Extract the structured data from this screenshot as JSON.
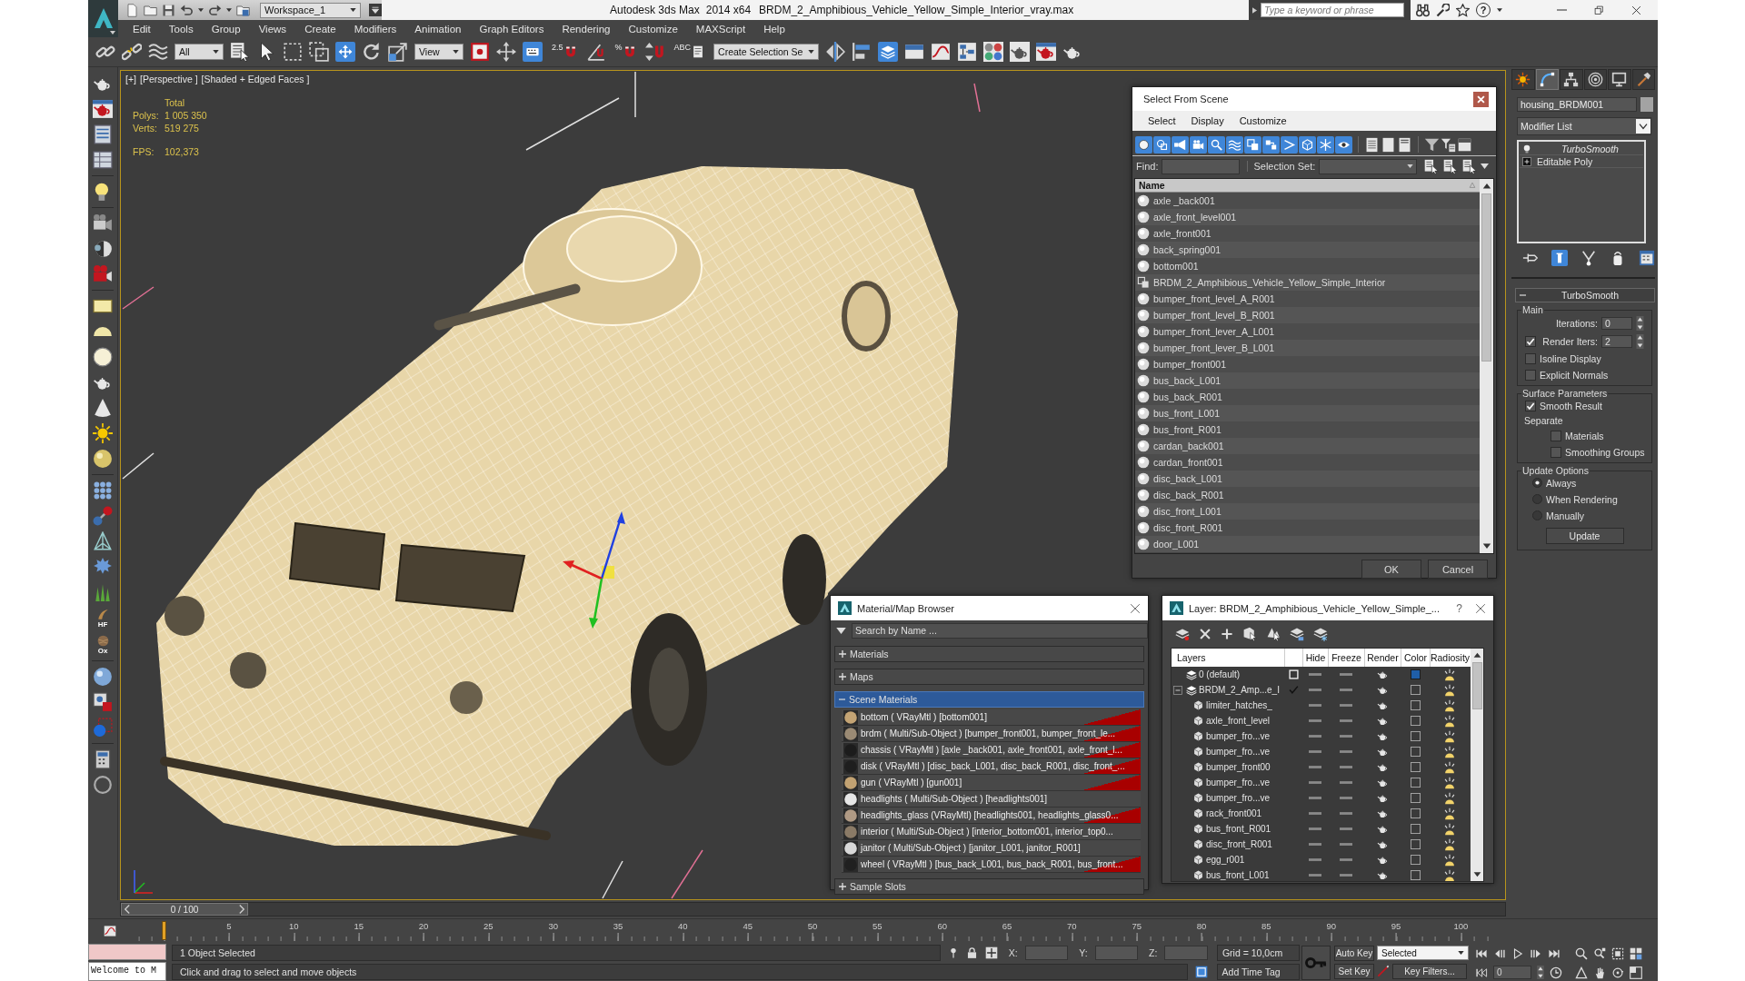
{
  "title_bar": {
    "workspace": "Workspace_1",
    "app_name": "Autodesk 3ds Max",
    "version": "2014 x64",
    "file_name": "BRDM_2_Amphibious_Vehicle_Yellow_Simple_Interior_vray.max",
    "search": {
      "placeholder": "Type a keyword or phrase"
    },
    "help": "?"
  },
  "menu_bar": [
    "Edit",
    "Tools",
    "Group",
    "Views",
    "Create",
    "Modifiers",
    "Animation",
    "Graph Editors",
    "Rendering",
    "Customize",
    "MAXScript",
    "Help"
  ],
  "main_toolbar": [
    {
      "kind": "link",
      "selected": false
    },
    {
      "kind": "unlink",
      "selected": false
    },
    {
      "kind": "bind",
      "selected": false
    },
    {
      "kind": "dropdown",
      "value": "All"
    },
    {
      "kind": "select_by_name",
      "selected": false
    },
    {
      "kind": "select",
      "selected": false
    },
    {
      "kind": "region",
      "selected": false
    },
    {
      "kind": "crossing",
      "selected": false
    },
    {
      "kind": "move",
      "selected": true
    },
    {
      "kind": "rotate",
      "selected": false
    },
    {
      "kind": "scale",
      "selected": false
    },
    {
      "kind": "dropdown",
      "value": "View"
    },
    {
      "kind": "pivot",
      "selected": false
    },
    {
      "kind": "manipulate",
      "selected": false
    },
    {
      "kind": "keyboard",
      "selected": true
    },
    {
      "kind": "snap",
      "label": "2.5",
      "selected": false
    },
    {
      "kind": "angle_snap",
      "selected": false
    },
    {
      "kind": "percent_snap",
      "label": "%",
      "selected": false
    },
    {
      "kind": "spinner_snap",
      "selected": false
    },
    {
      "kind": "edit_named",
      "label": "ABC",
      "selected": false
    },
    {
      "kind": "dropdown",
      "value": "Create Selection Se"
    },
    {
      "kind": "mirror",
      "selected": false
    },
    {
      "kind": "align",
      "selected": false
    },
    {
      "kind": "layers",
      "selected": true
    },
    {
      "kind": "ribbon",
      "selected": false
    },
    {
      "kind": "curve_editor",
      "selected": false
    },
    {
      "kind": "schematic",
      "selected": false
    },
    {
      "kind": "material_editor",
      "selected": false
    },
    {
      "kind": "render_setup",
      "selected": false
    },
    {
      "kind": "frame_window",
      "selected": false
    },
    {
      "kind": "render",
      "selected": false
    }
  ],
  "left_toolbar": {
    "labels": [
      "HF",
      "Ox"
    ]
  },
  "viewport": {
    "labels": [
      "[+]",
      "[Perspective ]",
      "[Shaded + Edged Faces ]"
    ],
    "stats_heading": "Total",
    "stats": [
      {
        "label": "Polys:",
        "value": "1 005 350"
      },
      {
        "label": "Verts:",
        "value": "519 275"
      },
      {
        "label": "FPS:",
        "value": "102,373"
      }
    ]
  },
  "select_from_scene": {
    "title": "Select From Scene",
    "menu": [
      "Select",
      "Display",
      "Customize"
    ],
    "filters": [
      {
        "kind": "geometry",
        "selected": true
      },
      {
        "kind": "shapes",
        "selected": true
      },
      {
        "kind": "lights",
        "selected": true
      },
      {
        "kind": "cameras",
        "selected": true
      },
      {
        "kind": "helpers",
        "selected": true
      },
      {
        "kind": "space_warps",
        "selected": true
      },
      {
        "kind": "groups",
        "selected": true
      },
      {
        "kind": "xrefs",
        "selected": true
      },
      {
        "kind": "bones",
        "selected": true
      },
      {
        "kind": "containers",
        "selected": true
      },
      {
        "kind": "frozen",
        "selected": true
      },
      {
        "kind": "hidden",
        "selected": true
      }
    ],
    "find_label": "Find:",
    "selection_set_label": "Selection Set:",
    "column": "Name",
    "objects": [
      {
        "name": "axle _back001",
        "kind": "object",
        "selected": false
      },
      {
        "name": "axle_front_level001",
        "kind": "object",
        "selected": false
      },
      {
        "name": "axle_front001",
        "kind": "object",
        "selected": false
      },
      {
        "name": "back_spring001",
        "kind": "object",
        "selected": false
      },
      {
        "name": "bottom001",
        "kind": "object",
        "selected": false
      },
      {
        "name": "BRDM_2_Amphibious_Vehicle_Yellow_Simple_Interior",
        "kind": "group",
        "selected": false
      },
      {
        "name": "bumper_front_level_A_R001",
        "kind": "object",
        "selected": false
      },
      {
        "name": "bumper_front_level_B_R001",
        "kind": "object",
        "selected": false
      },
      {
        "name": "bumper_front_lever_A_L001",
        "kind": "object",
        "selected": false
      },
      {
        "name": "bumper_front_lever_B_L001",
        "kind": "object",
        "selected": false
      },
      {
        "name": "bumper_front001",
        "kind": "object",
        "selected": false
      },
      {
        "name": "bus_back_L001",
        "kind": "object",
        "selected": false
      },
      {
        "name": "bus_back_R001",
        "kind": "object",
        "selected": false
      },
      {
        "name": "bus_front_L001",
        "kind": "object",
        "selected": false
      },
      {
        "name": "bus_front_R001",
        "kind": "object",
        "selected": false
      },
      {
        "name": "cardan_back001",
        "kind": "object",
        "selected": false
      },
      {
        "name": "cardan_front001",
        "kind": "object",
        "selected": false
      },
      {
        "name": "disc_back_L001",
        "kind": "object",
        "selected": false
      },
      {
        "name": "disc_back_R001",
        "kind": "object",
        "selected": false
      },
      {
        "name": "disc_front_L001",
        "kind": "object",
        "selected": false
      },
      {
        "name": "disc_front_R001",
        "kind": "object",
        "selected": false
      },
      {
        "name": "door_L001",
        "kind": "object",
        "selected": false
      }
    ],
    "buttons": [
      "OK",
      "Cancel"
    ]
  },
  "material_browser": {
    "title": "Material/Map Browser",
    "search": {
      "placeholder": "Search by Name ..."
    },
    "groups": [
      {
        "label": "Materials",
        "expanded": false,
        "selected": false
      },
      {
        "label": "Maps",
        "expanded": false,
        "selected": false
      },
      {
        "label": "Scene Materials",
        "expanded": true,
        "selected": true,
        "items": [
          {
            "text": "bottom ( VRayMtl ) [bottom001]",
            "color": "#c4a474",
            "hot": true
          },
          {
            "text": "brdm ( Multi/Sub-Object ) [bumper_front001, bumper_front_le...",
            "color": "#9a8a74",
            "hot": true
          },
          {
            "text": "chassis ( VRayMtl ) [axle _back001, axle_front001, axle_front_l...",
            "color": "#1c1c1c",
            "hot": true
          },
          {
            "text": "disk ( VRayMtl ) [disc_back_L001, disc_back_R001, disc_front_...",
            "color": "#1e1e1e",
            "hot": true
          },
          {
            "text": "gun ( VRayMtl ) [gun001]",
            "color": "#c2a272",
            "hot": true
          },
          {
            "text": "headlights ( Multi/Sub-Object ) [headlights001]",
            "color": "#e6e6e6",
            "hot": false
          },
          {
            "text": "headlights_glass (VRayMtl) [headlights001, headlights_glass0...",
            "color": "#b09a84",
            "hot": true
          },
          {
            "text": "interior ( Multi/Sub-Object ) [interior_bottom001, interior_top0...",
            "color": "#8a7a66",
            "hot": false
          },
          {
            "text": "janitor ( Multi/Sub-Object ) [janitor_L001, janitor_R001]",
            "color": "#d8d8d8",
            "hot": false
          },
          {
            "text": "wheel ( VRayMtl ) [bus_back_L001, bus_back_R001, bus_front...",
            "color": "#202020",
            "hot": true
          }
        ]
      },
      {
        "label": "Sample Slots",
        "expanded": false,
        "selected": false
      }
    ]
  },
  "layer_manager": {
    "title": "Layer: BRDM_2_Amphibious_Vehicle_Yellow_Simple_...",
    "help": "?",
    "columns": [
      "Layers",
      "Hide",
      "Freeze",
      "Render",
      "Color",
      "Radiosity"
    ],
    "layers": [
      {
        "name": "0 (default)",
        "current": false,
        "color": "#1f5ea8"
      },
      {
        "name": "BRDM_2_Amp...e_I",
        "current": true,
        "expanded": true,
        "children": [
          {
            "name": "limiter_hatches_"
          },
          {
            "name": "axle_front_level"
          },
          {
            "name": "bumper_fro...ve"
          },
          {
            "name": "bumper_fro...ve"
          },
          {
            "name": "bumper_front00"
          },
          {
            "name": "bumper_fro...ve"
          },
          {
            "name": "bumper_fro...ve"
          },
          {
            "name": "rack_front001"
          },
          {
            "name": "bus_front_R001"
          },
          {
            "name": "disc_front_R001"
          },
          {
            "name": "egg_r001"
          },
          {
            "name": "bus_front_L001"
          }
        ]
      }
    ]
  },
  "command_panel": {
    "tabs": [
      {
        "kind": "create",
        "selected": false
      },
      {
        "kind": "modify",
        "selected": true
      },
      {
        "kind": "hierarchy",
        "selected": false
      },
      {
        "kind": "motion",
        "selected": false
      },
      {
        "kind": "display",
        "selected": false
      },
      {
        "kind": "utilities",
        "selected": false
      }
    ],
    "object_name": "housing_BRDM001",
    "modifier_list": "Modifier List",
    "stack": [
      {
        "name": "TurboSmooth",
        "kind": "modifier"
      },
      {
        "name": "Editable Poly",
        "kind": "base_object"
      }
    ],
    "stack_tools": [
      {
        "kind": "pin",
        "selected": false
      },
      {
        "kind": "show_end_result",
        "selected": true
      },
      {
        "kind": "make_unique",
        "selected": false
      },
      {
        "kind": "remove",
        "selected": false
      },
      {
        "kind": "configure",
        "selected": false
      }
    ],
    "rollout": {
      "title": "TurboSmooth",
      "expanded": true,
      "groups": [
        {
          "title": "Main",
          "items": [
            {
              "kind": "spinner",
              "label": "Iterations:",
              "value": "0"
            },
            {
              "kind": "check_spinner",
              "label": "Render Iters:",
              "value": "2",
              "checked": true
            },
            {
              "kind": "checkbox",
              "label": "Isoline Display",
              "checked": false
            },
            {
              "kind": "checkbox",
              "label": "Explicit Normals",
              "checked": false
            }
          ]
        },
        {
          "title": "Surface Parameters",
          "items": [
            {
              "kind": "checkbox",
              "label": "Smooth Result",
              "checked": true
            },
            {
              "kind": "label",
              "label": "Separate",
              "children": [
                {
                  "kind": "checkbox",
                  "label": "Materials",
                  "checked": false
                },
                {
                  "kind": "checkbox",
                  "label": "Smoothing Groups",
                  "checked": false
                }
              ]
            }
          ]
        },
        {
          "title": "Update Options",
          "items": [
            {
              "kind": "radio",
              "label": "Always",
              "selected": true
            },
            {
              "kind": "radio",
              "label": "When Rendering",
              "selected": false
            },
            {
              "kind": "radio",
              "label": "Manually",
              "selected": false
            },
            {
              "kind": "button",
              "label": "Update"
            }
          ]
        }
      ]
    }
  },
  "time_slider": {
    "position": "0 / 100",
    "level": 0
  },
  "track_bar": {
    "ticks": [
      "5",
      "10",
      "15",
      "20",
      "25",
      "30",
      "35",
      "40",
      "45",
      "50",
      "55",
      "60",
      "65",
      "70",
      "75",
      "80",
      "85",
      "90",
      "95",
      "100"
    ]
  },
  "status_bar": {
    "listener_output": "Welcome to M",
    "selection": "1 Object Selected",
    "prompt": "Click and drag to select and move objects",
    "coordinates": [
      "X:",
      "Y:",
      "Z:"
    ],
    "grid": "Grid = 10,0cm",
    "add_time_tag": "Add Time Tag"
  },
  "animation_controls": {
    "auto_key": "Auto Key",
    "key_mode": "Selected",
    "set_key": "Set Key",
    "key_filters": "Key Filters...",
    "current_frame": "0"
  }
}
